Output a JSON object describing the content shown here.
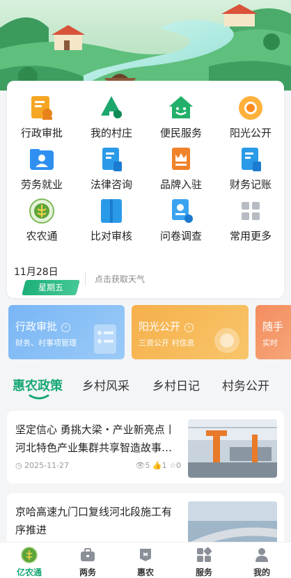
{
  "services": [
    {
      "label": "行政审批",
      "icon": "approval-doc-icon"
    },
    {
      "label": "我的村庄",
      "icon": "village-tree-icon"
    },
    {
      "label": "便民服务",
      "icon": "house-smile-icon"
    },
    {
      "label": "阳光公开",
      "icon": "sun-icon"
    },
    {
      "label": "劳务就业",
      "icon": "worker-folder-icon"
    },
    {
      "label": "法律咨询",
      "icon": "law-book-icon"
    },
    {
      "label": "品牌入驻",
      "icon": "brand-crown-icon"
    },
    {
      "label": "财务记账",
      "icon": "finance-book-icon"
    },
    {
      "label": "农农通",
      "icon": "nongnongtong-logo-icon"
    },
    {
      "label": "比对审核",
      "icon": "compare-book-icon"
    },
    {
      "label": "问卷调查",
      "icon": "survey-icon"
    },
    {
      "label": "常用更多",
      "icon": "more-grid-icon"
    }
  ],
  "weather": {
    "date": "11月28日",
    "weekday": "星期五",
    "tip": "点击获取天气"
  },
  "promos": [
    {
      "title": "行政审批",
      "subtitle": "财务、村事项管理",
      "color": "#7ab8f5"
    },
    {
      "title": "阳光公开",
      "subtitle": "三资公开 村信息",
      "color": "#f7b54f"
    },
    {
      "title": "随手",
      "subtitle": "实时",
      "color": "#f59a6a"
    }
  ],
  "tabs": [
    "惠农政策",
    "乡村风采",
    "乡村日记",
    "村务公开"
  ],
  "news": [
    {
      "title": "坚定信心 勇挑大梁・产业新亮点丨河北特色产业集群共享智造故事…",
      "date": "2025-11-27",
      "views": "5",
      "likes": "1",
      "favorites": "0"
    },
    {
      "title": "京哈高速九门口复线河北段施工有序推进"
    }
  ],
  "bottom_nav": [
    {
      "label": "亿农通",
      "icon": "yinongtong-logo-icon"
    },
    {
      "label": "两务",
      "icon": "briefcase-icon"
    },
    {
      "label": "惠农",
      "icon": "flag-icon"
    },
    {
      "label": "服务",
      "icon": "apps-icon"
    },
    {
      "label": "我的",
      "icon": "user-icon"
    }
  ],
  "colors": {
    "accent": "#17a874",
    "background": "#f4f5f7"
  }
}
